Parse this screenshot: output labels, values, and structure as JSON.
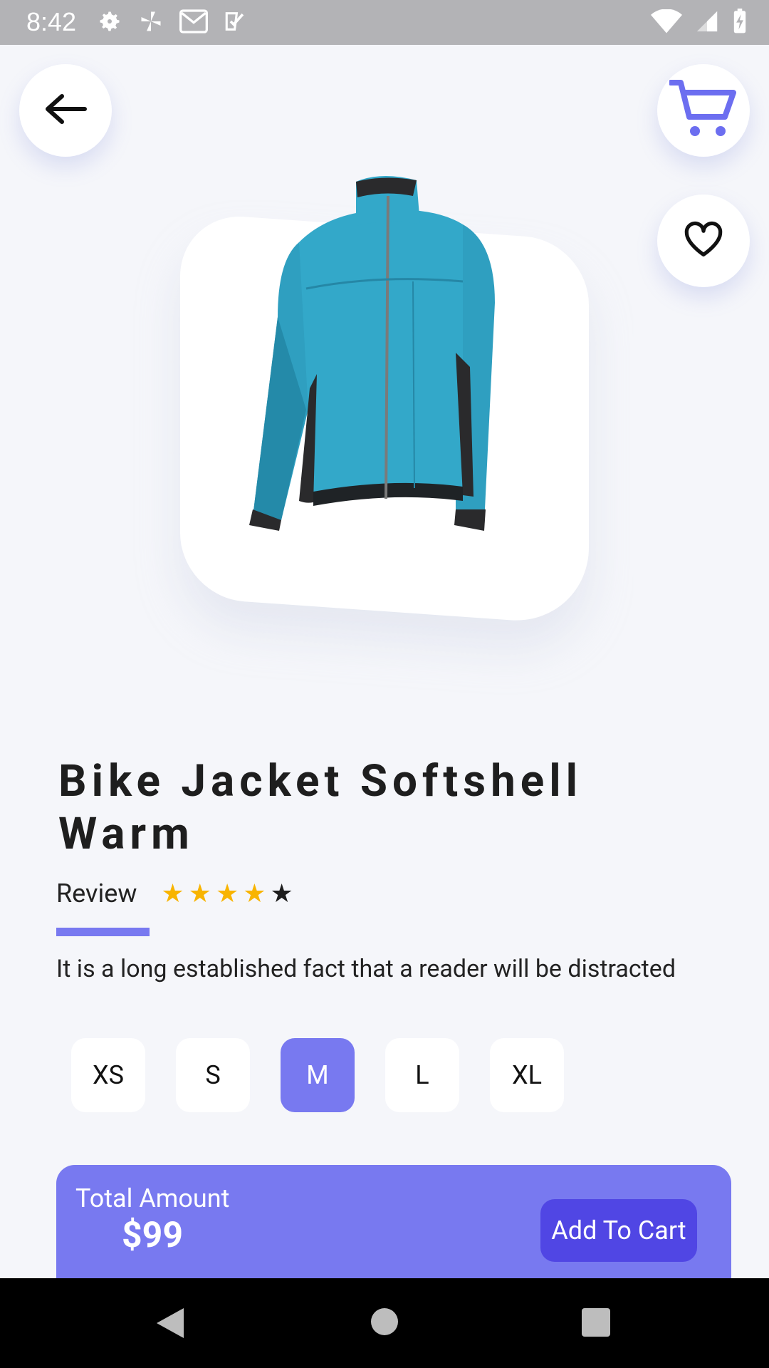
{
  "status_bar": {
    "time": "8:42",
    "left_icons": [
      "settings-icon",
      "pinwheel-icon",
      "gmail-icon",
      "task-check-icon"
    ],
    "right_icons": [
      "wifi-icon",
      "signal-icon",
      "battery-charging-icon"
    ]
  },
  "header": {
    "back_icon": "arrow-left-icon",
    "cart_icon": "shopping-cart-icon",
    "favorite_icon": "heart-outline-icon"
  },
  "product": {
    "title": "Bike Jacket Softshell Warm",
    "review_label": "Review",
    "rating": 4,
    "rating_max": 5,
    "description": "It is a long established fact that a reader will be distracted",
    "image": "teal-softshell-jacket-photo"
  },
  "sizes": {
    "options": [
      "XS",
      "S",
      "M",
      "L",
      "XL"
    ],
    "selected": "M"
  },
  "checkout": {
    "total_label": "Total Amount",
    "total_value": "$99",
    "add_to_cart_label": "Add To Cart"
  },
  "colors": {
    "accent": "#7879f0",
    "button_dark": "#5046e4",
    "star": "#f8b400",
    "background": "#f5f6fa"
  },
  "system_nav": {
    "icons": [
      "nav-back-icon",
      "nav-home-icon",
      "nav-recents-icon"
    ]
  }
}
